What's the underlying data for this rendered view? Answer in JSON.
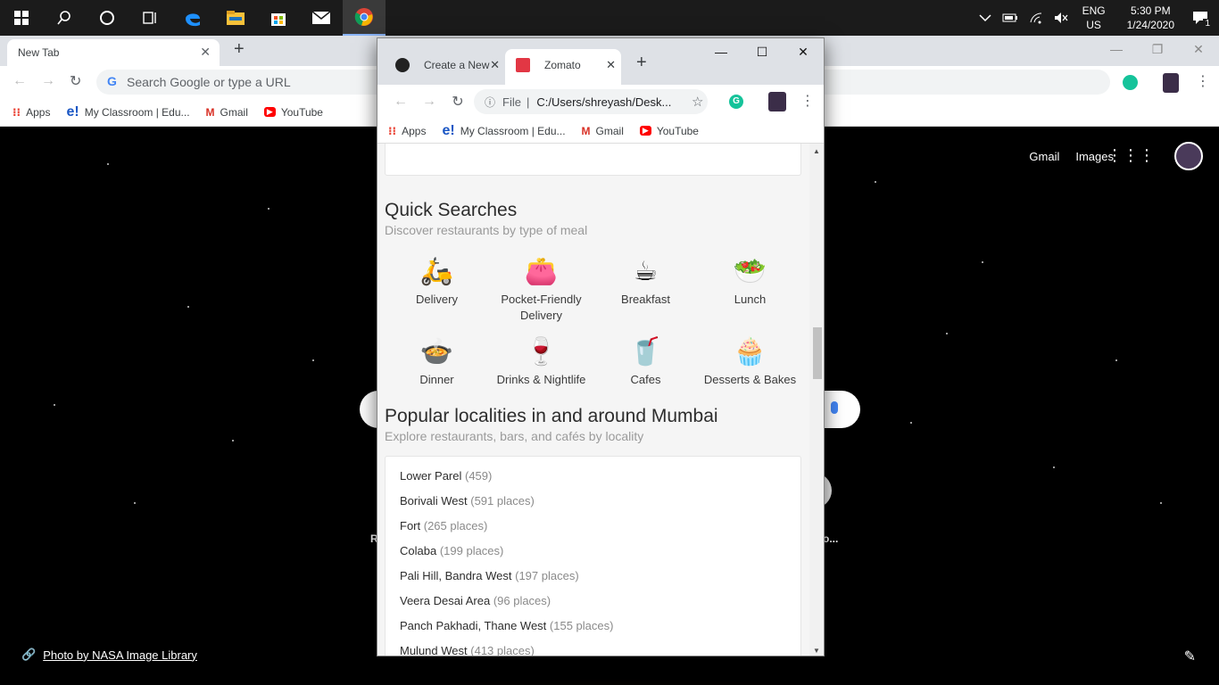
{
  "taskbar": {
    "icons": [
      "windows-start-icon",
      "search-icon",
      "cortana-icon",
      "task-view-icon",
      "edge-icon",
      "file-explorer-icon",
      "store-icon",
      "mail-icon",
      "chrome-icon"
    ],
    "lang_line1": "ENG",
    "lang_line2": "US",
    "time": "5:30 PM",
    "date": "1/24/2020",
    "notification_count": "1"
  },
  "bg_browser": {
    "tab_title": "New Tab",
    "omnibox_placeholder": "Search Google or type a URL",
    "bookmarks": [
      "Apps",
      "My Classroom | Edu...",
      "Gmail",
      "YouTube"
    ]
  },
  "newtab_page": {
    "gmail_link": "Gmail",
    "images_link": "Images",
    "bottom_left_fragment": "R",
    "bottom_right_fragment": "o...",
    "photo_credit": "Photo by NASA Image Library"
  },
  "front_browser": {
    "tabs": [
      "Create a New",
      "Zomato"
    ],
    "omnibox_scheme": "File",
    "omnibox_url": "C:/Users/shreyash/Desk...",
    "bookmarks": [
      "Apps",
      "My Classroom | Edu...",
      "Gmail",
      "YouTube"
    ]
  },
  "quick_searches": {
    "title": "Quick Searches",
    "subtitle": "Discover restaurants by type of meal",
    "items": [
      {
        "label": "Delivery",
        "icon": "🛵"
      },
      {
        "label": "Pocket-Friendly Delivery",
        "icon": "👛"
      },
      {
        "label": "Breakfast",
        "icon": "☕"
      },
      {
        "label": "Lunch",
        "icon": "🥗"
      },
      {
        "label": "Dinner",
        "icon": "🍲"
      },
      {
        "label": "Drinks & Nightlife",
        "icon": "🍷"
      },
      {
        "label": "Cafes",
        "icon": "🥤"
      },
      {
        "label": "Desserts & Bakes",
        "icon": "🧁"
      }
    ]
  },
  "popular_localities": {
    "title": "Popular localities in and around Mumbai",
    "subtitle": "Explore restaurants, bars, and cafés by locality",
    "items": [
      {
        "name": "Lower Parel",
        "count": "(459)"
      },
      {
        "name": "Borivali West",
        "count": "(591 places)"
      },
      {
        "name": "Fort",
        "count": "(265 places)"
      },
      {
        "name": "Colaba",
        "count": "(199 places)"
      },
      {
        "name": "Pali Hill, Bandra West",
        "count": "(197 places)"
      },
      {
        "name": "Veera Desai Area",
        "count": "(96 places)"
      },
      {
        "name": "Panch Pakhadi, Thane West",
        "count": "(155 places)"
      },
      {
        "name": "Mulund West",
        "count": "(413 places)"
      }
    ]
  }
}
